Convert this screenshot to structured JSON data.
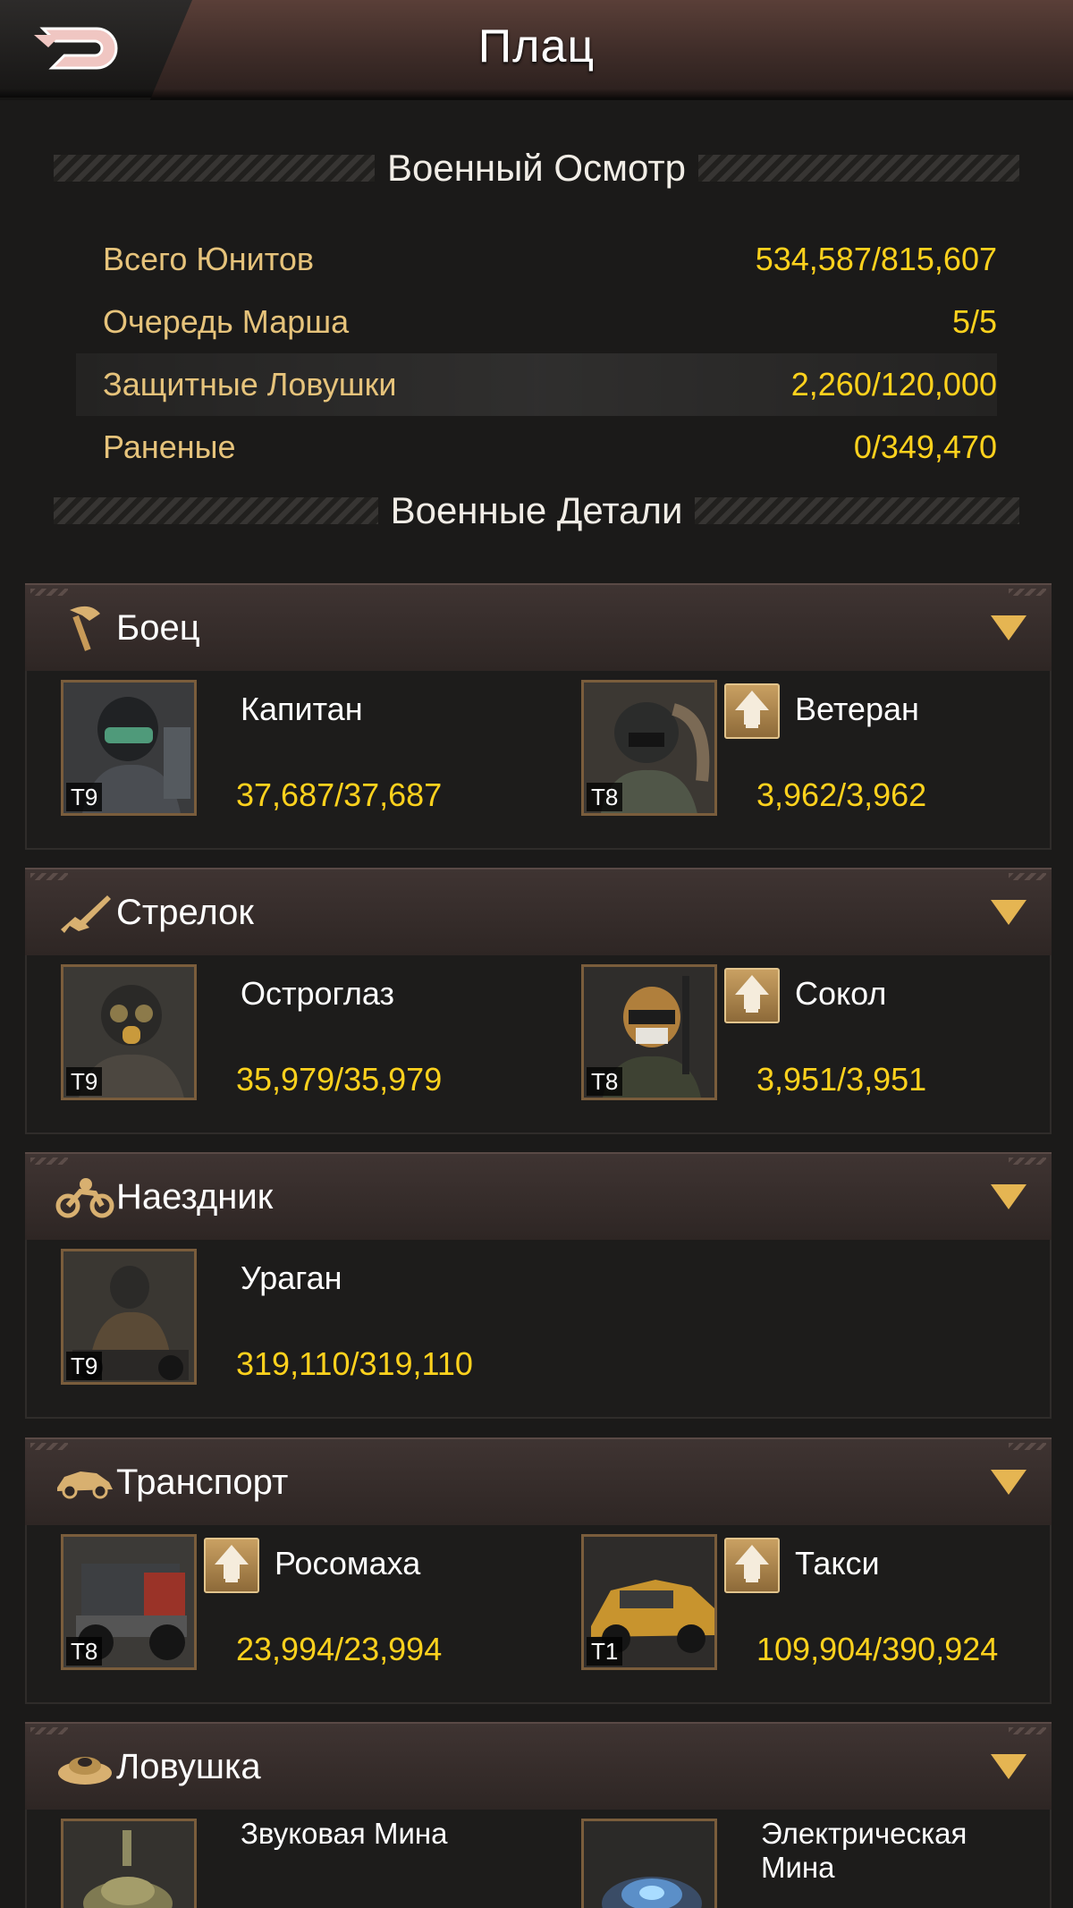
{
  "header": {
    "title": "Плац",
    "back_icon": "back-arrow-icon"
  },
  "inspection": {
    "title": "Военный Осмотр",
    "rows": [
      {
        "label": "Всего Юнитов",
        "value": "534,587/815,607"
      },
      {
        "label": "Очередь Марша",
        "value": "5/5"
      },
      {
        "label": "Защитные Ловушки",
        "value": "2,260/120,000"
      },
      {
        "label": "Раненые",
        "value": "0/349,470"
      }
    ]
  },
  "details": {
    "title": "Военные Детали"
  },
  "categories": [
    {
      "name": "Боец",
      "icon": "axe-icon",
      "units": [
        {
          "name": "Капитан",
          "tier": "T9",
          "count": "37,687/37,687",
          "upgrade": false
        },
        {
          "name": "Ветеран",
          "tier": "T8",
          "count": "3,962/3,962",
          "upgrade": true
        }
      ]
    },
    {
      "name": "Стрелок",
      "icon": "rifle-icon",
      "units": [
        {
          "name": "Остроглаз",
          "tier": "T9",
          "count": "35,979/35,979",
          "upgrade": false
        },
        {
          "name": "Сокол",
          "tier": "T8",
          "count": "3,951/3,951",
          "upgrade": true
        }
      ]
    },
    {
      "name": "Наездник",
      "icon": "motorcycle-icon",
      "units": [
        {
          "name": "Ураган",
          "tier": "T9",
          "count": "319,110/319,110",
          "upgrade": false
        }
      ]
    },
    {
      "name": "Транспорт",
      "icon": "car-icon",
      "units": [
        {
          "name": "Росомаха",
          "tier": "T8",
          "count": "23,994/23,994",
          "upgrade": true
        },
        {
          "name": "Такси",
          "tier": "T1",
          "count": "109,904/390,924",
          "upgrade": true
        }
      ]
    },
    {
      "name": "Ловушка",
      "icon": "mine-icon",
      "units": [
        {
          "name": "Звуковая Мина",
          "tier": "",
          "count": "",
          "upgrade": false
        },
        {
          "name": "Электрическая Мина",
          "tier": "",
          "count": "",
          "upgrade": false
        }
      ]
    }
  ],
  "colors": {
    "label": "#e6c37b",
    "value": "#ffd21d",
    "arrow": "#e5b552"
  }
}
